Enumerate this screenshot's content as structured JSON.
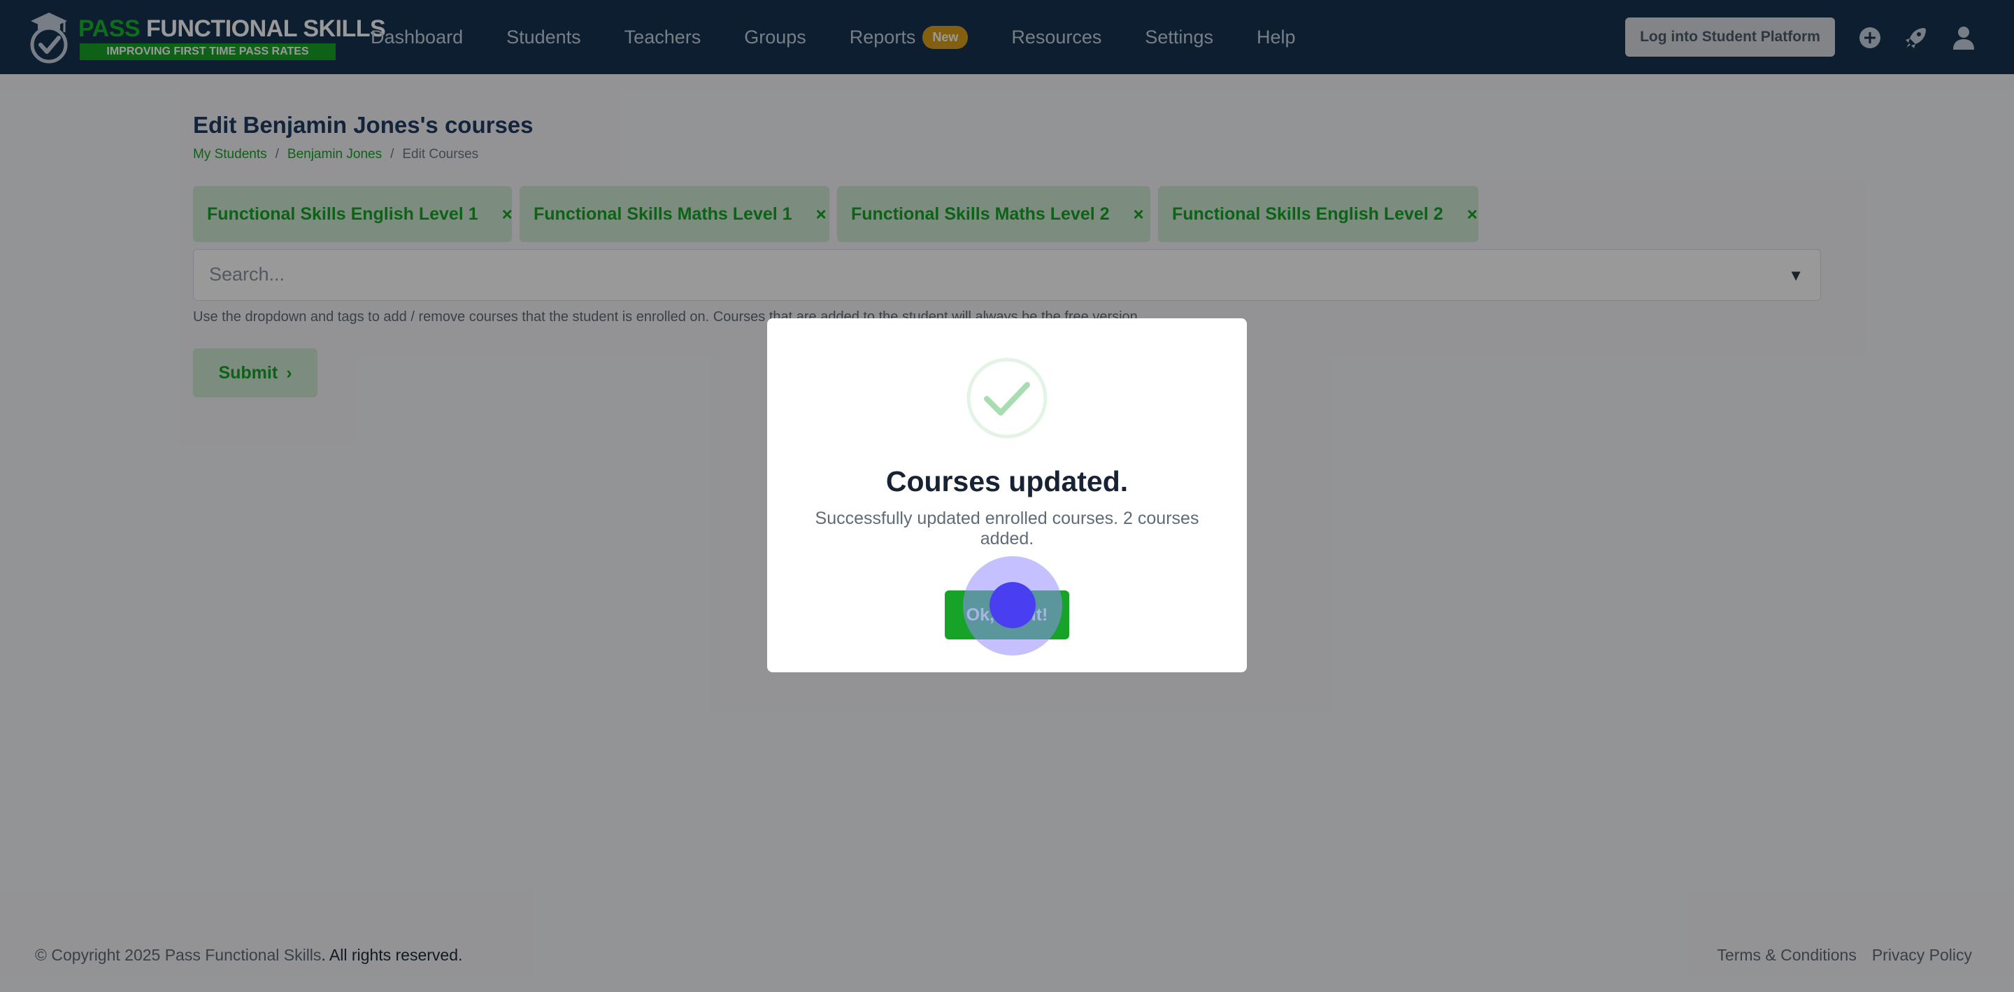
{
  "navbar": {
    "logo_title_part1": "PASS",
    "logo_title_part2": "FUNCTIONAL SKILLS",
    "logo_tagline": "IMPROVING FIRST TIME PASS RATES",
    "links": [
      {
        "label": "Dashboard"
      },
      {
        "label": "Students"
      },
      {
        "label": "Teachers"
      },
      {
        "label": "Groups"
      },
      {
        "label": "Reports",
        "badge": "New"
      },
      {
        "label": "Resources"
      },
      {
        "label": "Settings"
      },
      {
        "label": "Help"
      }
    ],
    "login_button": "Log into Student Platform",
    "icons": [
      "plus-circle-icon",
      "rocket-icon",
      "user-icon"
    ],
    "colors": {
      "background": "#173253",
      "brand_green": "#16a327",
      "badge": "#d9a01c"
    }
  },
  "page": {
    "title": "Edit Benjamin Jones's courses",
    "breadcrumb": [
      {
        "label": "My Students"
      },
      {
        "label": "Benjamin Jones"
      },
      {
        "label": "Edit Courses"
      }
    ],
    "breadcrumb_separator": "/",
    "tags": [
      {
        "label": "Functional Skills English Level 1",
        "remove": "×"
      },
      {
        "label": "Functional Skills Maths Level 1",
        "remove": "×"
      },
      {
        "label": "Functional Skills Maths Level 2",
        "remove": "×"
      },
      {
        "label": "Functional Skills English Level 2",
        "remove": "×"
      }
    ],
    "search_placeholder": "Search...",
    "dropdown_caret": "▼",
    "help_text": "Use the dropdown and tags to add / remove courses that the student is enrolled on. Courses that are added to the student will always be the free version.",
    "submit_label": "Submit",
    "submit_chevron": "›"
  },
  "modal": {
    "title": "Courses updated.",
    "text": "Successfully updated enrolled courses. 2 courses added.",
    "ok_label": "Ok, got it!",
    "icon": "check-circle-icon"
  },
  "footer": {
    "copyright_prefix": "© Copyright 2025 Pass Functional Skills",
    "copyright_suffix": ". All rights reserved.",
    "links": [
      {
        "label": "Terms & Conditions"
      },
      {
        "label": "Privacy Policy"
      }
    ]
  }
}
